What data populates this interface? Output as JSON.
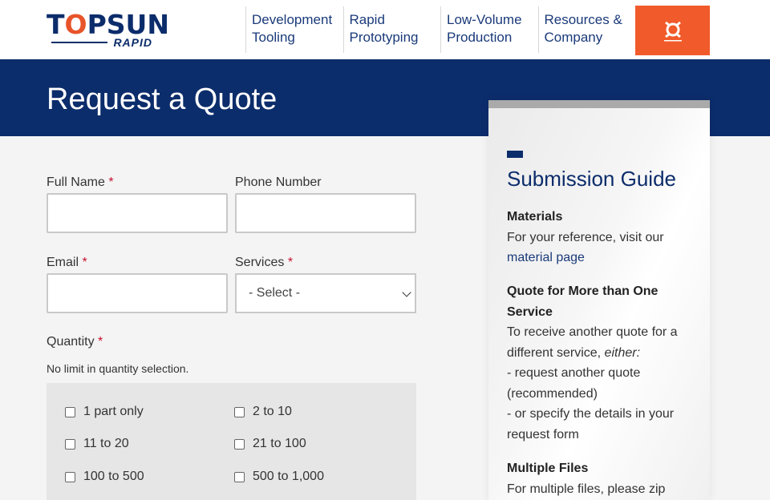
{
  "header": {
    "logo_main_left": "T",
    "logo_main_o": "O",
    "logo_main_right": "PSUN",
    "logo_sub": "RAPID",
    "nav": [
      {
        "line1": "Development",
        "line2": "Tooling"
      },
      {
        "line1": "Rapid",
        "line2": "Prototyping"
      },
      {
        "line1": "Low-Volume",
        "line2": "Production"
      },
      {
        "line1": "Resources &",
        "line2": "Company"
      }
    ],
    "cta_icon": "quote-icon",
    "accent_color": "#f15a2b",
    "brand_color": "#0c2d6b"
  },
  "banner": {
    "title": "Request a Quote"
  },
  "form": {
    "full_name_label": "Full Name",
    "phone_label": "Phone Number",
    "email_label": "Email",
    "services_label": "Services",
    "services_selected": "- Select -",
    "quantity_label": "Quantity",
    "required_mark": "*",
    "quantity_hint": "No limit in quantity selection.",
    "quantity_options": [
      "1 part only",
      "2 to 10",
      "11 to 20",
      "21 to 100",
      "100 to 500",
      "500 to 1,000"
    ]
  },
  "guide": {
    "title": "Submission Guide",
    "materials_head": "Materials",
    "materials_text": "For your reference, visit our",
    "materials_link": "material page",
    "multi_head": "Quote for More than One Service",
    "multi_text_1": "To receive another quote for a different service,",
    "multi_text_em": "either:",
    "multi_text_2": "- request another quote (recommended)",
    "multi_text_3": "- or specify the details in your request form",
    "files_head": "Multiple Files",
    "files_text": "For multiple files, please zip"
  }
}
